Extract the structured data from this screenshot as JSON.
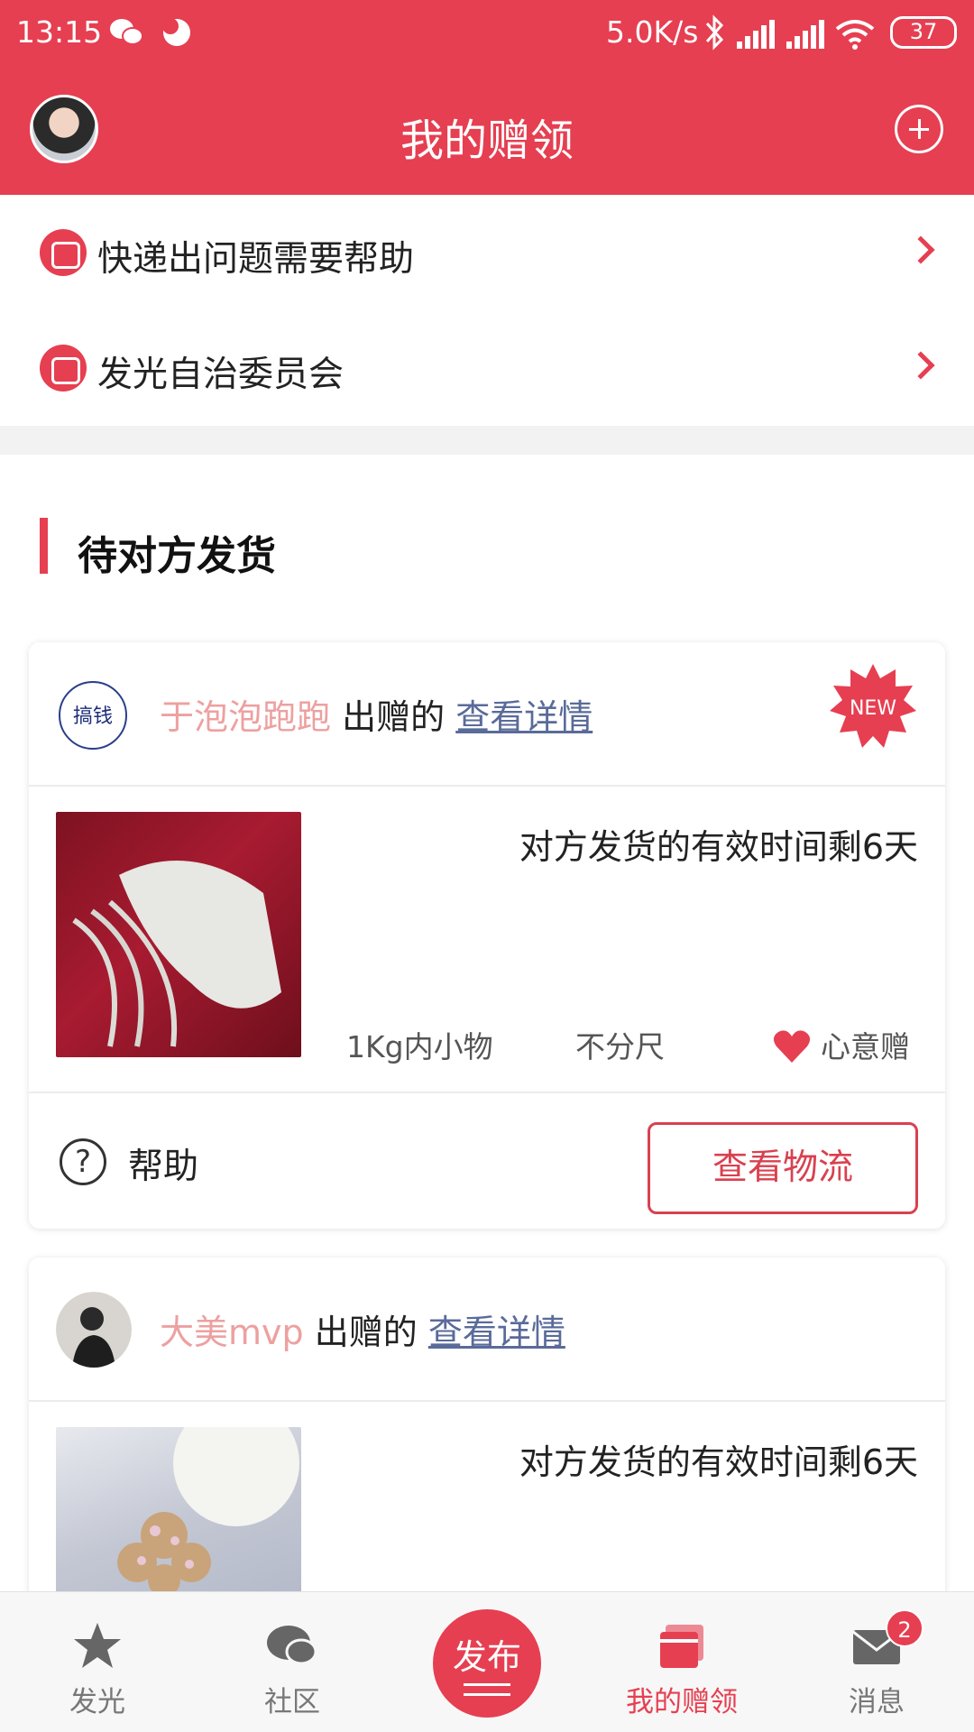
{
  "status_bar": {
    "time": "13:15",
    "network_speed": "5.0K/s",
    "battery": "37"
  },
  "header": {
    "title": "我的赠领"
  },
  "menu": {
    "items": [
      {
        "label": "快递出问题需要帮助"
      },
      {
        "label": "发光自治委员会"
      }
    ]
  },
  "section": {
    "title": "待对方发货"
  },
  "cards": [
    {
      "donor_name": "于泡泡跑跑",
      "donor_verb": "出赠的",
      "detail_link": "查看详情",
      "badge": "NEW",
      "avatar_text": "搞钱",
      "remaining": "对方发货的有效时间剩6天",
      "category": "1Kg内小物",
      "size": "不分尺",
      "gift_type": "心意赠",
      "help_label": "帮助",
      "logistics_button": "查看物流"
    },
    {
      "donor_name": "大美mvp",
      "donor_verb": "出赠的",
      "detail_link": "查看详情",
      "remaining": "对方发货的有效时间剩6天"
    }
  ],
  "bottom_nav": {
    "items": [
      {
        "label": "发光",
        "icon": "star-icon"
      },
      {
        "label": "社区",
        "icon": "chat-icon"
      },
      {
        "label": "发布",
        "icon": "publish-icon"
      },
      {
        "label": "我的赠领",
        "icon": "gift-box-icon"
      },
      {
        "label": "消息",
        "icon": "mail-icon"
      }
    ],
    "message_badge": "2"
  },
  "colors": {
    "brand": "#e63f51",
    "donor_name": "#eda0a0",
    "link": "#5a6b9a"
  }
}
